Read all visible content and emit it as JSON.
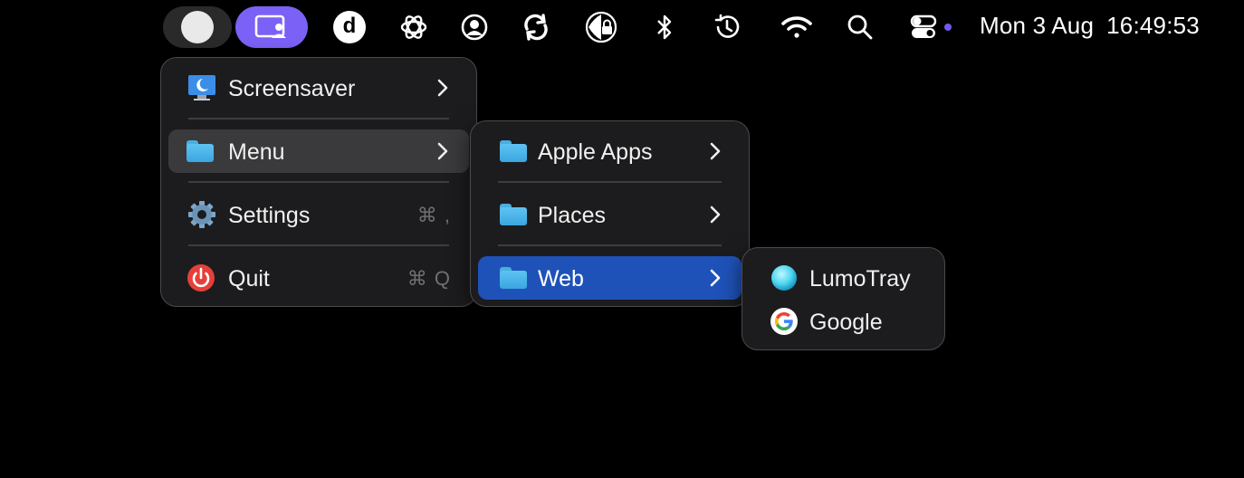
{
  "menubar": {
    "date": "Mon 3 Aug",
    "time": "16:49:53",
    "d_app_letter": "d",
    "icons": [
      "toggle-circle-icon",
      "screen-sharing-icon",
      "d-app-icon",
      "openai-icon",
      "account-icon",
      "sync-icon",
      "lock-icon",
      "bluetooth-icon",
      "time-machine-icon",
      "wifi-icon",
      "search-icon",
      "control-center-icon"
    ],
    "accent_purple": "#7b61f5"
  },
  "main_menu": {
    "items": [
      {
        "label": "Screensaver",
        "icon": "screensaver-icon",
        "has_submenu": true
      },
      {
        "label": "Menu",
        "icon": "folder-icon",
        "has_submenu": true,
        "state": "hover"
      },
      {
        "label": "Settings",
        "icon": "gear-icon",
        "shortcut": "⌘ ,"
      },
      {
        "label": "Quit",
        "icon": "power-icon",
        "shortcut": "⌘ Q"
      }
    ]
  },
  "submenu": {
    "items": [
      {
        "label": "Apple Apps",
        "icon": "folder-icon",
        "has_submenu": true
      },
      {
        "label": "Places",
        "icon": "folder-icon",
        "has_submenu": true
      },
      {
        "label": "Web",
        "icon": "folder-icon",
        "has_submenu": true,
        "state": "selected"
      }
    ],
    "selected_color": "#1f52b8"
  },
  "web_menu": {
    "items": [
      {
        "label": "LumoTray",
        "icon": "lumotray-icon"
      },
      {
        "label": "Google",
        "icon": "google-icon"
      }
    ]
  }
}
